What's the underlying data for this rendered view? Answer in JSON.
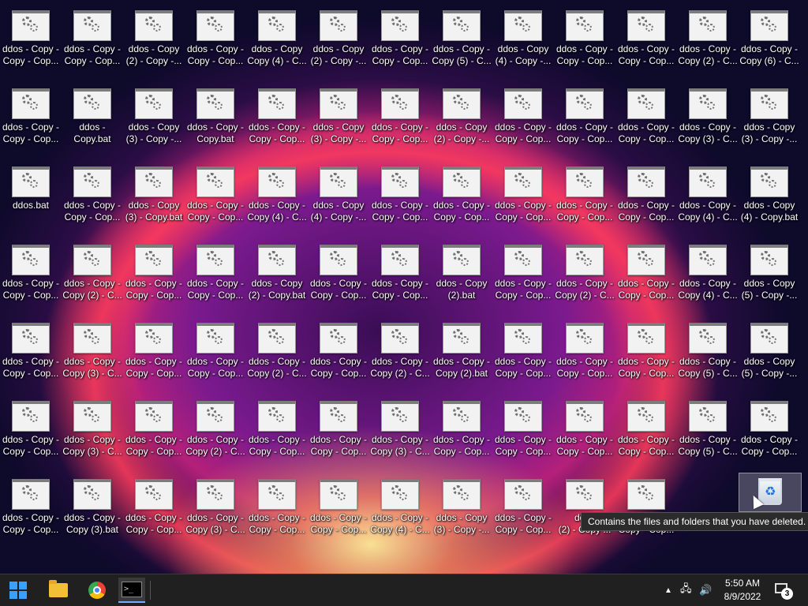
{
  "desktop": {
    "rows": [
      [
        [
          "ddos - Copy -",
          "Copy - Cop..."
        ],
        [
          "ddos - Copy -",
          "Copy - Cop..."
        ],
        [
          "ddos - Copy",
          "(2) - Copy -..."
        ],
        [
          "ddos - Copy -",
          "Copy - Cop..."
        ],
        [
          "ddos - Copy",
          "Copy (4) - C..."
        ],
        [
          "ddos - Copy",
          "(2) - Copy -..."
        ],
        [
          "ddos - Copy -",
          "Copy - Cop..."
        ],
        [
          "ddos - Copy -",
          "Copy (5) - C..."
        ],
        [
          "ddos - Copy",
          "(4) - Copy -..."
        ],
        [
          "ddos - Copy -",
          "Copy - Cop..."
        ],
        [
          "ddos - Copy -",
          "Copy - Cop..."
        ],
        [
          "ddos - Copy -",
          "Copy (2) - C..."
        ],
        [
          "ddos - Copy -",
          "Copy (6) - C..."
        ]
      ],
      [
        [
          "ddos - Copy -",
          "Copy - Cop..."
        ],
        [
          "ddos -",
          "Copy.bat"
        ],
        [
          "ddos - Copy",
          "(3) - Copy -..."
        ],
        [
          "ddos - Copy -",
          "Copy.bat"
        ],
        [
          "ddos - Copy -",
          "Copy - Cop..."
        ],
        [
          "ddos - Copy",
          "(3) - Copy -..."
        ],
        [
          "ddos - Copy -",
          "Copy - Cop..."
        ],
        [
          "ddos - Copy",
          "(2) - Copy -..."
        ],
        [
          "ddos - Copy -",
          "Copy - Cop..."
        ],
        [
          "ddos - Copy -",
          "Copy - Cop..."
        ],
        [
          "ddos - Copy -",
          "Copy - Cop..."
        ],
        [
          "ddos - Copy -",
          "Copy (3) - C..."
        ],
        [
          "ddos - Copy",
          "(3) - Copy -..."
        ]
      ],
      [
        [
          "ddos.bat",
          ""
        ],
        [
          "ddos - Copy -",
          "Copy - Cop..."
        ],
        [
          "ddos - Copy",
          "(3) - Copy.bat"
        ],
        [
          "ddos - Copy -",
          "Copy - Cop..."
        ],
        [
          "ddos - Copy -",
          "Copy (4) - C..."
        ],
        [
          "ddos - Copy",
          "(4) - Copy -..."
        ],
        [
          "ddos - Copy -",
          "Copy - Cop..."
        ],
        [
          "ddos - Copy -",
          "Copy - Cop..."
        ],
        [
          "ddos - Copy -",
          "Copy - Cop..."
        ],
        [
          "ddos - Copy -",
          "Copy - Cop..."
        ],
        [
          "ddos - Copy -",
          "Copy - Cop..."
        ],
        [
          "ddos - Copy -",
          "Copy (4) - C..."
        ],
        [
          "ddos - Copy",
          "(4) - Copy.bat"
        ]
      ],
      [
        [
          "ddos - Copy -",
          "Copy - Cop..."
        ],
        [
          "ddos - Copy -",
          "Copy (2) - C..."
        ],
        [
          "ddos - Copy -",
          "Copy - Cop..."
        ],
        [
          "ddos - Copy -",
          "Copy - Cop..."
        ],
        [
          "ddos - Copy",
          "(2) - Copy.bat"
        ],
        [
          "ddos - Copy -",
          "Copy - Cop..."
        ],
        [
          "ddos - Copy -",
          "Copy - Cop..."
        ],
        [
          "ddos - Copy",
          "(2).bat"
        ],
        [
          "ddos - Copy -",
          "Copy - Cop..."
        ],
        [
          "ddos - Copy -",
          "Copy (2) - C..."
        ],
        [
          "ddos - Copy -",
          "Copy - Cop..."
        ],
        [
          "ddos - Copy -",
          "Copy (4) - C..."
        ],
        [
          "ddos - Copy",
          "(5) - Copy -..."
        ]
      ],
      [
        [
          "ddos - Copy -",
          "Copy - Cop..."
        ],
        [
          "ddos - Copy -",
          "Copy (3) - C..."
        ],
        [
          "ddos - Copy -",
          "Copy - Cop..."
        ],
        [
          "ddos - Copy -",
          "Copy - Cop..."
        ],
        [
          "ddos - Copy -",
          "Copy (2) - C..."
        ],
        [
          "ddos - Copy -",
          "Copy - Cop..."
        ],
        [
          "ddos - Copy -",
          "Copy (2) - C..."
        ],
        [
          "ddos - Copy -",
          "Copy (2).bat"
        ],
        [
          "ddos - Copy -",
          "Copy - Cop..."
        ],
        [
          "ddos - Copy -",
          "Copy - Cop..."
        ],
        [
          "ddos - Copy -",
          "Copy - Cop..."
        ],
        [
          "ddos - Copy -",
          "Copy (5) - C..."
        ],
        [
          "ddos - Copy",
          "(5) - Copy -..."
        ]
      ],
      [
        [
          "ddos - Copy -",
          "Copy - Cop..."
        ],
        [
          "ddos - Copy -",
          "Copy (3) - C..."
        ],
        [
          "ddos - Copy -",
          "Copy - Cop..."
        ],
        [
          "ddos - Copy -",
          "Copy (2) - C..."
        ],
        [
          "ddos - Copy -",
          "Copy - Cop..."
        ],
        [
          "ddos - Copy -",
          "Copy - Cop..."
        ],
        [
          "ddos - Copy -",
          "Copy (3) - C..."
        ],
        [
          "ddos - Copy -",
          "Copy - Cop..."
        ],
        [
          "ddos - Copy -",
          "Copy - Cop..."
        ],
        [
          "ddos - Copy -",
          "Copy - Cop..."
        ],
        [
          "ddos - Copy -",
          "Copy - Cop..."
        ],
        [
          "ddos - Copy -",
          "Copy (5) - C..."
        ],
        [
          "ddos - Copy -",
          "Copy - Cop..."
        ]
      ],
      [
        [
          "ddos - Copy -",
          "Copy - Cop..."
        ],
        [
          "ddos - Copy -",
          "Copy (3).bat"
        ],
        [
          "ddos - Copy -",
          "Copy - Cop..."
        ],
        [
          "ddos - Copy -",
          "Copy (3) - C..."
        ],
        [
          "ddos - Copy -",
          "Copy - Cop..."
        ],
        [
          "ddos - Copy -",
          "Copy - Cop..."
        ],
        [
          "ddos - Copy -",
          "Copy (4) - C..."
        ],
        [
          "ddos - Copy",
          "(3) - Copy -..."
        ],
        [
          "ddos - Copy -",
          "Copy - Cop..."
        ],
        [
          "ddos",
          "(2) - Copy ..."
        ],
        [
          "ddos - Copy -",
          "Copy - Cop..."
        ]
      ]
    ],
    "recycle_bin_icon": "recycle-bin-icon"
  },
  "tooltip": {
    "text": "Contains the files and folders that you have deleted."
  },
  "taskbar": {
    "icons": [
      "windows-start-icon",
      "file-explorer-icon",
      "chrome-icon",
      "terminal-icon"
    ],
    "terminal_glyph": ">_",
    "tray": {
      "chevron": "▲",
      "network": "🖧",
      "volume": "🔊"
    },
    "clock": {
      "time": "5:50 AM",
      "date": "8/9/2022"
    },
    "notifications": {
      "count": "3"
    }
  }
}
